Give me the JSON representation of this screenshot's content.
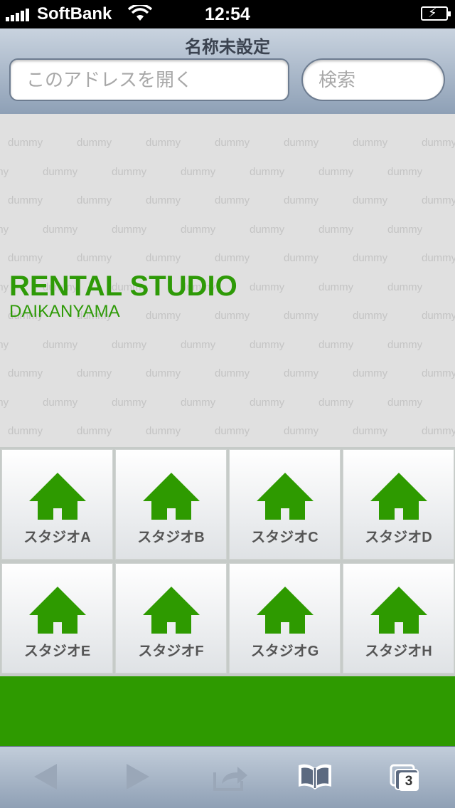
{
  "status_bar": {
    "carrier": "SoftBank",
    "time": "12:54"
  },
  "browser": {
    "page_title": "名称未設定",
    "address_placeholder": "このアドレスを開く",
    "search_placeholder": "検索"
  },
  "hero": {
    "pattern_word": "dummy",
    "title": "RENTAL STUDIO",
    "subtitle": "DAIKANYAMA"
  },
  "studios": [
    {
      "label": "スタジオA",
      "icon": "home-icon"
    },
    {
      "label": "スタジオB",
      "icon": "home-icon"
    },
    {
      "label": "スタジオC",
      "icon": "home-icon"
    },
    {
      "label": "スタジオD",
      "icon": "home-icon"
    },
    {
      "label": "スタジオE",
      "icon": "home-icon"
    },
    {
      "label": "スタジオF",
      "icon": "home-icon"
    },
    {
      "label": "スタジオG",
      "icon": "home-icon"
    },
    {
      "label": "スタジオH",
      "icon": "home-icon"
    }
  ],
  "toolbar": {
    "tab_count": "3"
  },
  "colors": {
    "accent": "#2e9a00",
    "hero_bg": "#e0e0e0"
  }
}
